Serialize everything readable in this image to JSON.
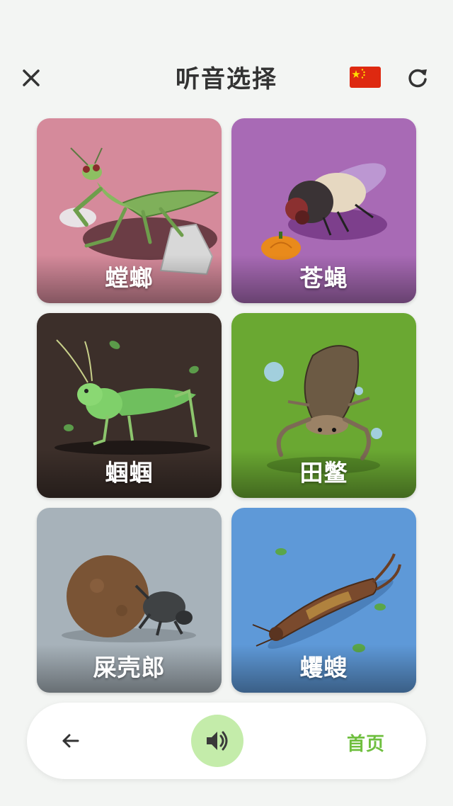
{
  "header": {
    "title": "听音选择",
    "close_icon": "close-icon",
    "flag_icon": "china-flag-icon",
    "refresh_icon": "refresh-icon"
  },
  "cards": [
    {
      "label": "螳螂",
      "bg": "#d58a9b",
      "illustration": "praying-mantis"
    },
    {
      "label": "苍蝇",
      "bg": "#a86ab5",
      "illustration": "fly"
    },
    {
      "label": "蝈蝈",
      "bg": "#3c2f2a",
      "illustration": "katydid"
    },
    {
      "label": "田鳖",
      "bg": "#6aa832",
      "illustration": "giant-water-bug"
    },
    {
      "label": "屎壳郎",
      "bg": "#a7b2ba",
      "illustration": "dung-beetle"
    },
    {
      "label": "蠼螋",
      "bg": "#5e99d8",
      "illustration": "earwig"
    }
  ],
  "bottom_bar": {
    "back_icon": "arrow-left-icon",
    "speaker_icon": "speaker-icon",
    "home_label": "首页"
  },
  "colors": {
    "accent_green": "#6fbf3f",
    "speaker_bg": "#c4ecaa",
    "title_text": "#333333"
  }
}
